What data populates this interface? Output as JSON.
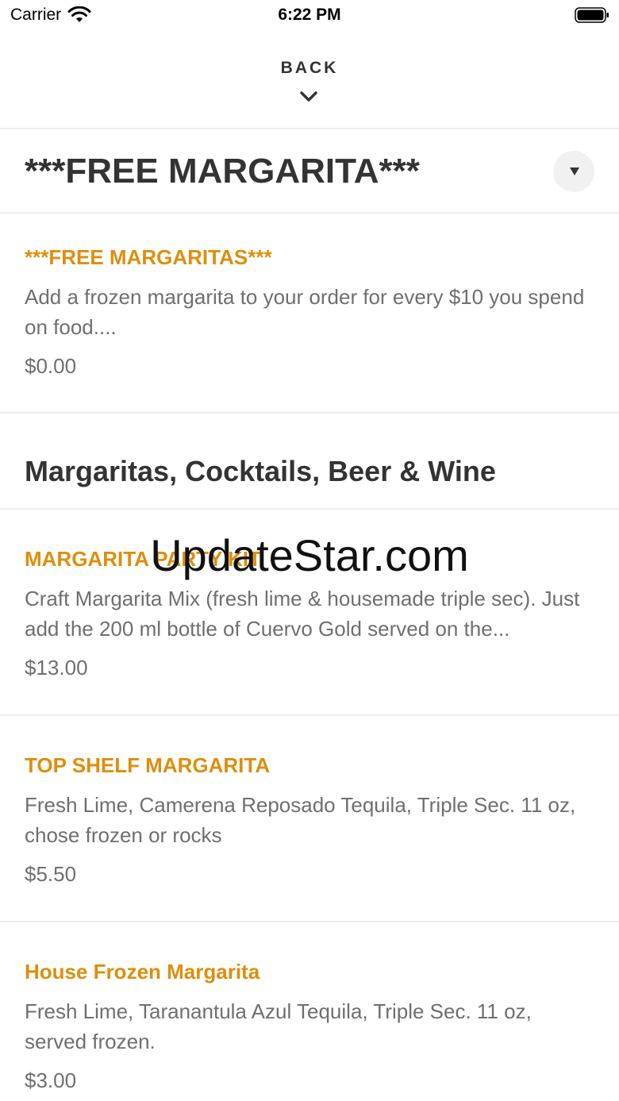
{
  "status_bar": {
    "carrier": "Carrier",
    "time": "6:22 PM"
  },
  "nav": {
    "back_label": "BACK"
  },
  "category": {
    "title": "***FREE MARGARITA***"
  },
  "free_item": {
    "name": "***FREE MARGARITAS***",
    "description": "Add a frozen margarita to your order for every $10 you spend on food....",
    "price": "$0.00"
  },
  "section": {
    "title": "Margaritas, Cocktails, Beer & Wine"
  },
  "items": [
    {
      "name": "MARGARITA PARTY KIT",
      "description": "Craft Margarita Mix (fresh lime & housemade triple sec). Just add the 200 ml bottle of Cuervo Gold served on the...",
      "price": "$13.00"
    },
    {
      "name": "TOP SHELF MARGARITA",
      "description": "Fresh Lime, Camerena Reposado Tequila, Triple Sec. 11 oz, chose frozen or rocks",
      "price": "$5.50"
    },
    {
      "name": "House Frozen Margarita",
      "description": "Fresh Lime, Taranantula Azul Tequila, Triple Sec. 11 oz, served frozen.",
      "price": "$3.00"
    }
  ],
  "watermark": "UpdateStar.com",
  "colors": {
    "accent": "#de8e0d",
    "text": "#333333",
    "muted": "#6f6f6f",
    "divider": "#ececec"
  },
  "icons": {
    "wifi": "wifi-icon",
    "battery": "battery-icon",
    "back": "chevron-down-icon",
    "dropdown": "caret-down-icon"
  }
}
